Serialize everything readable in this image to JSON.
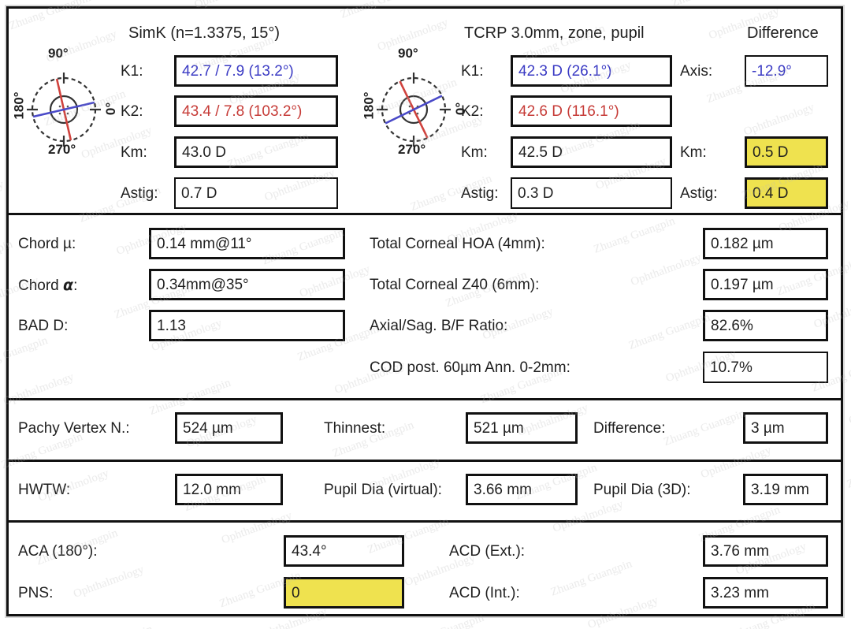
{
  "sections": {
    "top": {
      "col_headers": {
        "simk": "SimK (n=1.3375, 15°)",
        "tcrp": "TCRP 3.0mm, zone, pupil",
        "difference": "Difference"
      },
      "compass_left": {
        "deg_top": "90",
        "deg_right": "0",
        "deg_left": "180",
        "deg_bottom": "270",
        "degree_symbol": "°",
        "flat_axis_deg": 13.2,
        "steep_axis_deg": 103.2
      },
      "compass_right": {
        "deg_top": "90",
        "deg_right": "0",
        "deg_left": "180",
        "deg_bottom": "270",
        "degree_symbol": "°",
        "flat_axis_deg": 26.1,
        "steep_axis_deg": 116.1
      },
      "simk_rows": [
        {
          "label": "K1:",
          "value": "42.7 / 7.9 (13.2°)",
          "color": "blue"
        },
        {
          "label": "K2:",
          "value": "43.4 / 7.8 (103.2°)",
          "color": "red"
        },
        {
          "label": "Km:",
          "value": "43.0 D",
          "color": "black"
        },
        {
          "label": "Astig:",
          "value": "0.7 D",
          "color": "black"
        }
      ],
      "tcrp_rows": [
        {
          "label": "K1:",
          "value": "42.3 D (26.1°)",
          "color": "blue"
        },
        {
          "label": "K2:",
          "value": "42.6 D (116.1°)",
          "color": "red"
        },
        {
          "label": "Km:",
          "value": "42.5 D",
          "color": "black"
        },
        {
          "label": "Astig:",
          "value": "0.3 D",
          "color": "black"
        }
      ],
      "difference_rows": [
        {
          "label": "Axis:",
          "value": "-12.9°",
          "color": "blue",
          "highlight": false
        },
        {
          "label": "Km:",
          "value": "0.5 D",
          "color": "black",
          "highlight": true
        },
        {
          "label": "Astig:",
          "value": "0.4 D",
          "color": "black",
          "highlight": true
        }
      ]
    },
    "middle": {
      "left_rows": [
        {
          "label_pre": "Chord ",
          "label_sym": "µ",
          "label_post": ":",
          "value": "0.14 mm@11°"
        },
        {
          "label_pre": "Chord ",
          "label_sym": "α",
          "label_post": ":",
          "value": "0.34mm@35°"
        },
        {
          "label_pre": "BAD D:",
          "label_sym": "",
          "label_post": "",
          "value": "1.13"
        }
      ],
      "right_rows": [
        {
          "label": "Total Corneal HOA (4mm):",
          "value": "0.182 µm"
        },
        {
          "label": "Total Corneal Z40 (6mm):",
          "value": "0.197 µm"
        },
        {
          "label": "Axial/Sag. B/F Ratio:",
          "value": "82.6%"
        },
        {
          "label": "COD post. 60µm Ann. 0-2mm:",
          "value": "10.7%"
        }
      ]
    },
    "pachy": {
      "row1": [
        {
          "label": "Pachy Vertex N.:",
          "value": "524 µm"
        },
        {
          "label": "Thinnest:",
          "value": "521 µm"
        },
        {
          "label": "Difference:",
          "value": "3 µm"
        }
      ],
      "row2": [
        {
          "label": "HWTW:",
          "value": "12.0 mm"
        },
        {
          "label": "Pupil Dia (virtual):",
          "value": "3.66 mm"
        },
        {
          "label": "Pupil Dia (3D):",
          "value": "3.19 mm"
        }
      ]
    },
    "bottom": {
      "left_rows": [
        {
          "label": "ACA (180°):",
          "value": "43.4°",
          "highlight": false
        },
        {
          "label": "PNS:",
          "value": "0",
          "highlight": true
        }
      ],
      "right_rows": [
        {
          "label": "ACD (Ext.):",
          "value": "3.76 mm"
        },
        {
          "label": "ACD (Int.):",
          "value": "3.23 mm"
        }
      ]
    }
  },
  "colors": {
    "flat_axis": "#3b3bc4",
    "steep_axis": "#c63b37",
    "highlight": "#efe24f",
    "frame": "#111111",
    "text": "#1f1f1f"
  }
}
